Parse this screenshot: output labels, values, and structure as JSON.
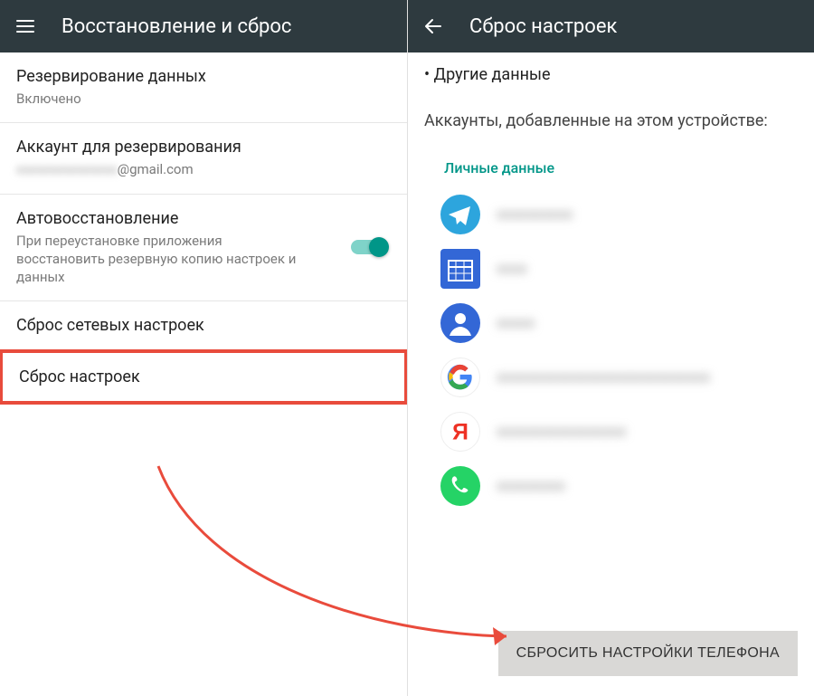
{
  "left": {
    "title": "Восстановление и сброс",
    "items": [
      {
        "primary": "Резервирование данных",
        "secondary": "Включено"
      },
      {
        "primary": "Аккаунт для резервирования",
        "secondary_blur": "xxxxxxxxxxxxxxx",
        "secondary_suffix": "@gmail.com"
      },
      {
        "primary": "Автовосстановление",
        "secondary": "При переустановке приложения восстановить резервную копию настроек и данных",
        "toggle": true
      },
      {
        "primary": "Сброс сетевых настроек"
      },
      {
        "primary": "Сброс настроек",
        "highlight": true
      }
    ]
  },
  "right": {
    "title": "Сброс настроек",
    "truncated_line": "• Другие данные",
    "accounts_heading": "Аккаунты, добавленные на этом устройстве:",
    "section_label": "Личные данные",
    "accounts": [
      {
        "icon": "telegram",
        "text": "xxxxxxxxxx"
      },
      {
        "icon": "calendar",
        "text": "xxxx"
      },
      {
        "icon": "contact",
        "text": "xxxxx"
      },
      {
        "icon": "google",
        "text": "xxxxxxxxxxxxxxxxxxxxxxxxxxxx"
      },
      {
        "icon": "yandex",
        "text": "xxxxxxxxxxxxxxxxx"
      },
      {
        "icon": "whatsapp",
        "text": "xxxxxxxxx"
      }
    ],
    "reset_button": "СБРОСИТЬ НАСТРОЙКИ ТЕЛЕФОНА"
  }
}
